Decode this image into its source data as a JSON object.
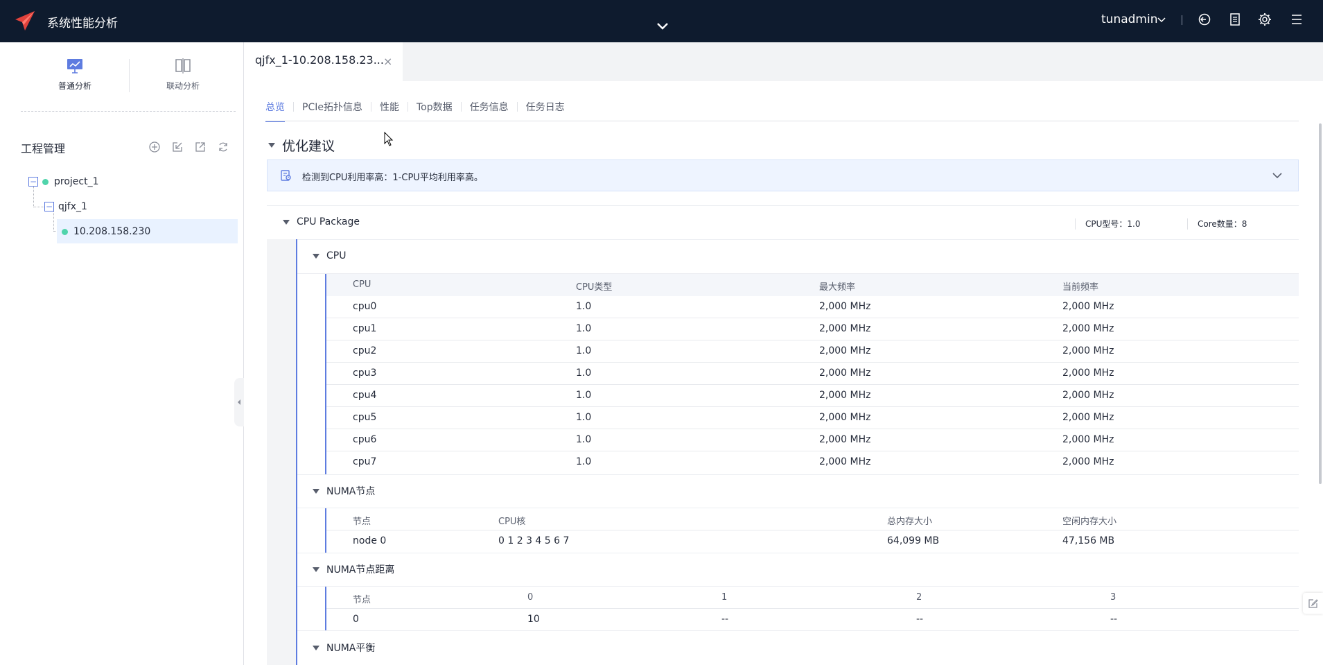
{
  "app": {
    "title": "系统性能分析",
    "user": "tunadmin"
  },
  "sidebar": {
    "modes": [
      {
        "label": "普通分析",
        "active": true
      },
      {
        "label": "联动分析",
        "active": false
      }
    ],
    "project_management_title": "工程管理",
    "toolbar_icons": [
      "add-circle-icon",
      "import-icon",
      "export-icon",
      "refresh-icon"
    ],
    "tree": {
      "project": "project_1",
      "task": "qjfx_1",
      "node": "10.208.158.230"
    }
  },
  "main": {
    "doc_tab": {
      "label": "qjfx_1-10.208.158.23...",
      "close": "×"
    },
    "subtabs": [
      {
        "label": "总览",
        "active": true
      },
      {
        "label": "PCIe拓扑信息",
        "active": false
      },
      {
        "label": "性能",
        "active": false
      },
      {
        "label": "Top数据",
        "active": false
      },
      {
        "label": "任务信息",
        "active": false
      },
      {
        "label": "任务日志",
        "active": false
      }
    ],
    "optimization": {
      "title": "优化建议",
      "suggestion": "检测到CPU利用率高：1-CPU平均利用率高。"
    },
    "cpu_package": {
      "title": "CPU Package",
      "cpu_model": "CPU型号：1.0",
      "core_count": "Core数量：8"
    },
    "cpu_section": {
      "title": "CPU",
      "headers": [
        "CPU",
        "CPU类型",
        "最大频率",
        "当前频率"
      ],
      "rows": [
        [
          "cpu0",
          "1.0",
          "2,000 MHz",
          "2,000 MHz"
        ],
        [
          "cpu1",
          "1.0",
          "2,000 MHz",
          "2,000 MHz"
        ],
        [
          "cpu2",
          "1.0",
          "2,000 MHz",
          "2,000 MHz"
        ],
        [
          "cpu3",
          "1.0",
          "2,000 MHz",
          "2,000 MHz"
        ],
        [
          "cpu4",
          "1.0",
          "2,000 MHz",
          "2,000 MHz"
        ],
        [
          "cpu5",
          "1.0",
          "2,000 MHz",
          "2,000 MHz"
        ],
        [
          "cpu6",
          "1.0",
          "2,000 MHz",
          "2,000 MHz"
        ],
        [
          "cpu7",
          "1.0",
          "2,000 MHz",
          "2,000 MHz"
        ]
      ]
    },
    "numa_nodes": {
      "title": "NUMA节点",
      "headers": [
        "节点",
        "CPU核",
        "总内存大小",
        "空闲内存大小"
      ],
      "rows": [
        [
          "node 0",
          "0 1 2 3 4 5 6 7",
          "64,099 MB",
          "47,156 MB"
        ]
      ]
    },
    "numa_distance": {
      "title": "NUMA节点距离",
      "headers": [
        "节点",
        "0",
        "1",
        "2",
        "3"
      ],
      "rows": [
        [
          "0",
          "10",
          "--",
          "--",
          "--"
        ]
      ]
    },
    "numa_balance": {
      "title": "NUMA平衡"
    }
  }
}
